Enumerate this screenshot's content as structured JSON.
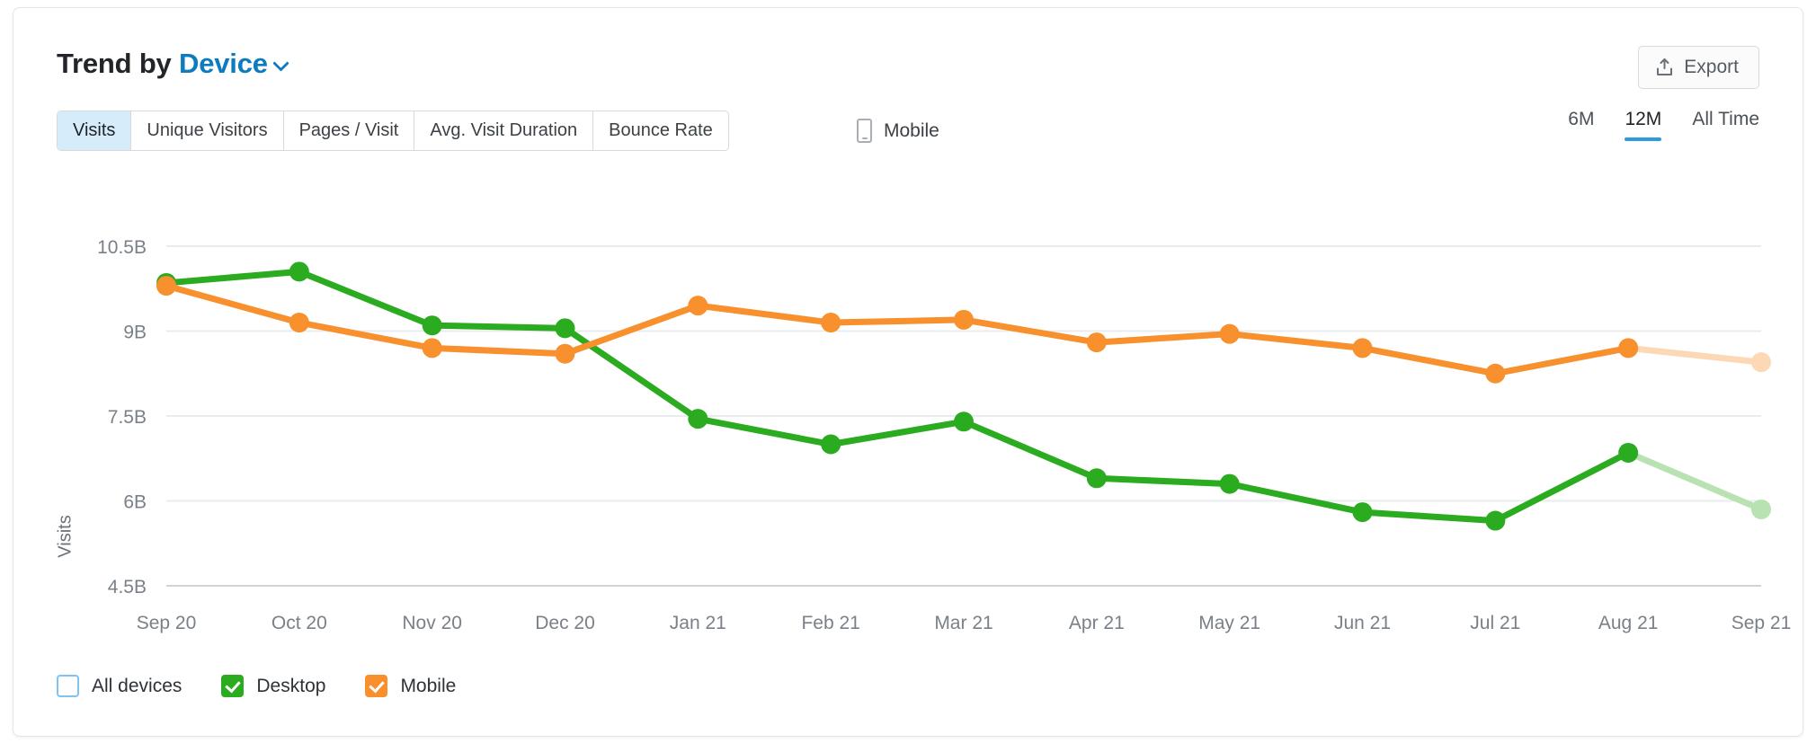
{
  "card": {
    "title_prefix": "Trend by ",
    "dimension": "Device",
    "dimension_icon": "chevron-down-icon"
  },
  "header": {
    "export_label": "Export",
    "export_icon": "upload-export-icon"
  },
  "toolbar": {
    "metrics": [
      {
        "label": "Visits",
        "active": true
      },
      {
        "label": "Unique Visitors",
        "active": false
      },
      {
        "label": "Pages / Visit",
        "active": false
      },
      {
        "label": "Avg. Visit Duration",
        "active": false
      },
      {
        "label": "Bounce Rate",
        "active": false
      }
    ],
    "device_filter": {
      "icon": "mobile-phone-icon",
      "label": "Mobile"
    },
    "ranges": [
      {
        "label": "6M",
        "active": false
      },
      {
        "label": "12M",
        "active": true
      },
      {
        "label": "All Time",
        "active": false
      }
    ]
  },
  "legend": [
    {
      "label": "All devices",
      "checked": false,
      "color": "#7fc4ee"
    },
    {
      "label": "Desktop",
      "checked": true,
      "color": "#2bab1f"
    },
    {
      "label": "Mobile",
      "checked": true,
      "color": "#f7902d"
    }
  ],
  "colors": {
    "accent_blue": "#2e9ae0",
    "link_blue": "#0d7bbf",
    "desktop_green": "#2bab1f",
    "mobile_orange": "#f7902d",
    "desktop_green_faded": "#b9e2b3",
    "mobile_orange_faded": "#fcd9b4",
    "grid": "#e9ecef",
    "axis_text": "#7a8088"
  },
  "chart_data": {
    "type": "line",
    "title": "Trend by Device",
    "xlabel": "",
    "ylabel": "Visits",
    "ylim": [
      4.5,
      10.5
    ],
    "ytick_labels": [
      "10.5B",
      "9B",
      "7.5B",
      "6B",
      "4.5B"
    ],
    "ytick_values": [
      10.5,
      9,
      7.5,
      6,
      4.5
    ],
    "grid": true,
    "legend_position": "bottom-left",
    "value_unit": "B",
    "categories": [
      "Sep 20",
      "Oct 20",
      "Nov 20",
      "Dec 20",
      "Jan 21",
      "Feb 21",
      "Mar 21",
      "Apr 21",
      "May 21",
      "Jun 21",
      "Jul 21",
      "Aug 21",
      "Sep 21"
    ],
    "projected_from_index": 11,
    "series": [
      {
        "name": "Desktop",
        "color": "#2bab1f",
        "faded_color": "#b9e2b3",
        "values": [
          9.85,
          10.05,
          9.1,
          9.05,
          7.45,
          7.0,
          7.4,
          6.4,
          6.3,
          5.8,
          5.65,
          6.85,
          5.85
        ]
      },
      {
        "name": "Mobile",
        "color": "#f7902d",
        "faded_color": "#fcd9b4",
        "values": [
          9.8,
          9.15,
          8.7,
          8.6,
          9.45,
          9.15,
          9.2,
          8.8,
          8.95,
          8.7,
          8.25,
          8.7,
          8.45
        ]
      }
    ]
  }
}
